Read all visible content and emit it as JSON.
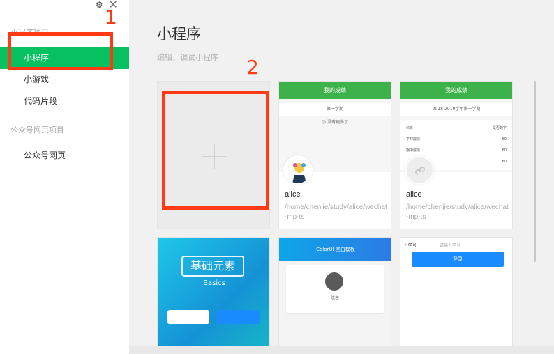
{
  "sidebar": {
    "window_controls": {
      "settings_icon": "gear-icon",
      "close_icon": "close-icon"
    },
    "section_miniprogram": "小程序项目",
    "items": [
      {
        "label": "小程序",
        "active": true
      },
      {
        "label": "小游戏",
        "active": false
      },
      {
        "label": "代码片段",
        "active": false
      }
    ],
    "section_official": "公众号网页项目",
    "official_items": [
      {
        "label": "公众号网页"
      }
    ]
  },
  "main": {
    "title": "小程序",
    "subtitle": "编辑、调试小程序",
    "new_project_icon": "plus-icon",
    "projects": [
      {
        "name": "alice",
        "path": "/home/chenjie/study/alice/wechat-mp-ts",
        "preview": {
          "header": "我的成绩",
          "row": "第一学期",
          "hint": "☺ 没有更多了"
        }
      },
      {
        "name": "alice",
        "path": "/home/chenjie/study/alice/wechat-mp-ts",
        "preview": {
          "header": "我的成绩",
          "row": "2018-2019学年第一学期",
          "table_head": [
            "科目",
            "是否数字"
          ],
          "rows": [
            [
              "平时成绩",
              "60"
            ],
            [
              "期中成绩",
              "60"
            ],
            [
              "",
              "60"
            ]
          ]
        }
      },
      {
        "preview": {
          "title": "基础元素",
          "subtitle": "Basics"
        }
      },
      {
        "preview": {
          "header": "ColorUI 空白模板",
          "person": "陈杰"
        }
      },
      {
        "preview": {
          "label": "学号",
          "placeholder": "请输入学号",
          "button": "登录"
        }
      }
    ]
  },
  "annotations": [
    {
      "label": "1"
    },
    {
      "label": "2"
    }
  ],
  "colors": {
    "accent": "#07c160",
    "highlight": "#ff3b16",
    "preview_header": "#3eb24a",
    "form_button": "#1b8cff"
  }
}
